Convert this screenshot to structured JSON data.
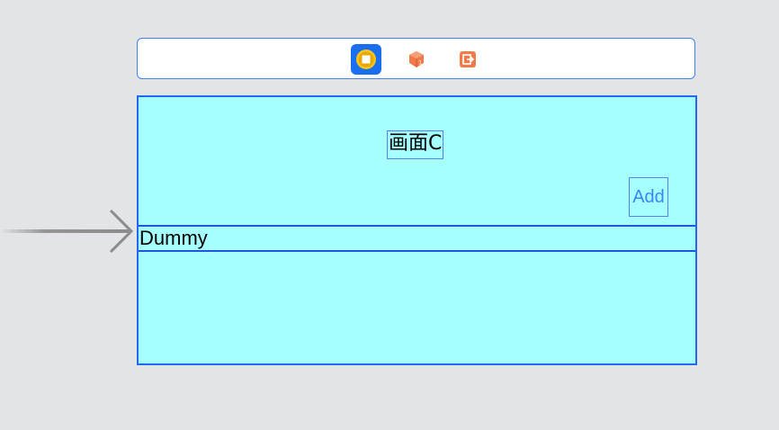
{
  "scene_dock": {
    "icons": [
      {
        "name": "view-controller-icon",
        "color": "#1a6ef0"
      },
      {
        "name": "first-responder-icon",
        "color": "#f07a4a"
      },
      {
        "name": "exit-icon",
        "color": "#f07a4a"
      }
    ]
  },
  "view": {
    "background": "#a5ffff",
    "title_label": "画面C",
    "add_button_label": "Add",
    "table_cell_label": "Dummy"
  },
  "entry_point": {
    "icon": "initial-view-controller-arrow-icon"
  }
}
